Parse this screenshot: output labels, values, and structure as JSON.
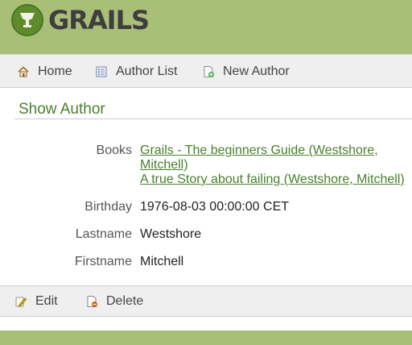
{
  "brand": {
    "name": "GRAILS"
  },
  "nav": {
    "home": "Home",
    "author_list": "Author List",
    "new_author": "New Author"
  },
  "page": {
    "title": "Show Author"
  },
  "author": {
    "fields": [
      {
        "label": "Books",
        "links": [
          "Grails - The beginners Guide (Westshore,",
          "Mitchell)",
          "A true Story about failing (Westshore, Mitchell)"
        ]
      },
      {
        "label": "Birthday",
        "value": "1976-08-03 00:00:00 CET"
      },
      {
        "label": "Lastname",
        "value": "Westshore"
      },
      {
        "label": "Firstname",
        "value": "Mitchell"
      }
    ]
  },
  "actions": {
    "edit": "Edit",
    "delete": "Delete"
  },
  "colors": {
    "header": "#a8bf78",
    "accent": "#48802c",
    "toolbar": "#efefef"
  },
  "icons": [
    "grails-logo-icon",
    "home-icon",
    "list-icon",
    "new-document-icon",
    "edit-icon",
    "delete-icon"
  ]
}
